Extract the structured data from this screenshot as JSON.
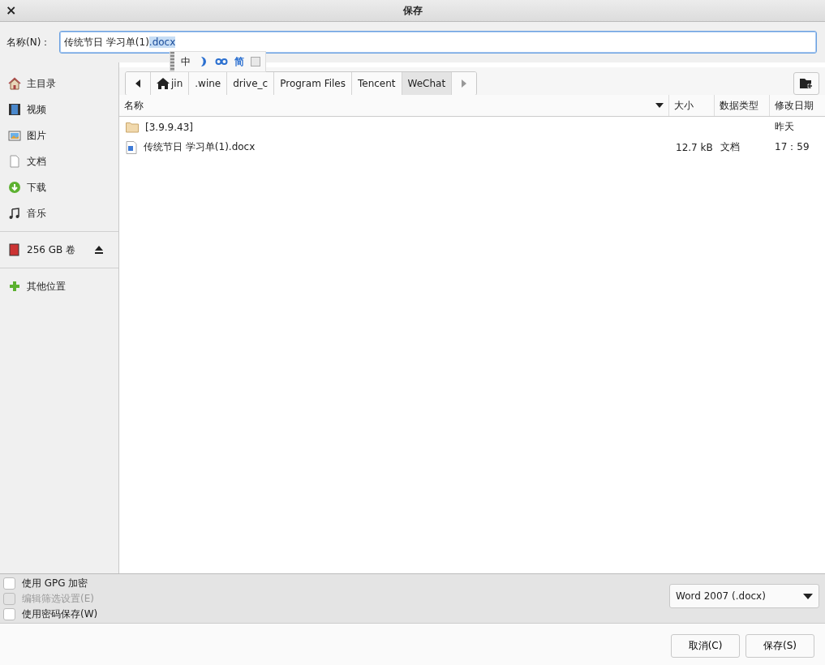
{
  "window": {
    "title": "保存",
    "close": "×"
  },
  "name_field": {
    "label": "名称(N)：",
    "value": "传统节日 学习单(1)",
    "selected_text": ".docx"
  },
  "ime_toolbar": {
    "items": [
      {
        "kind": "text",
        "label": "中"
      },
      {
        "kind": "moon"
      },
      {
        "kind": "dots"
      },
      {
        "kind": "text",
        "label": "简"
      },
      {
        "kind": "box"
      }
    ]
  },
  "sidebar": {
    "groups": [
      [
        {
          "label": "主目录",
          "kind": "home"
        },
        {
          "label": "视频",
          "kind": "video"
        },
        {
          "label": "图片",
          "kind": "image"
        },
        {
          "label": "文档",
          "kind": "doc"
        },
        {
          "label": "下载",
          "kind": "download"
        },
        {
          "label": "音乐",
          "kind": "music"
        }
      ],
      [
        {
          "label": "256 GB 卷",
          "kind": "card",
          "eject": true
        }
      ],
      [
        {
          "label": "其他位置",
          "kind": "plus"
        }
      ]
    ]
  },
  "path_bar": {
    "segments": [
      {
        "label": "jin",
        "home": true,
        "selected": false
      },
      {
        "label": ".wine",
        "home": false,
        "selected": false
      },
      {
        "label": "drive_c",
        "home": false,
        "selected": false
      },
      {
        "label": "Program Files",
        "home": false,
        "selected": false
      },
      {
        "label": "Tencent",
        "home": false,
        "selected": false
      },
      {
        "label": "WeChat",
        "home": false,
        "selected": true
      }
    ]
  },
  "table": {
    "columns": [
      "名称",
      "大小",
      "数据类型",
      "修改日期"
    ],
    "rows": [
      {
        "kind": "folder",
        "name": "[3.9.9.43]",
        "modified": "昨天"
      },
      {
        "kind": "document",
        "name": "传统节日 学习单(1).docx",
        "size": "12.7 kB",
        "type": "文档",
        "modified": "17：59"
      }
    ]
  },
  "options": [
    {
      "label": "使用 GPG 加密",
      "checked": false,
      "disabled": false
    },
    {
      "label": "编辑筛选设置(E)",
      "checked": false,
      "disabled": true
    },
    {
      "label": "使用密码保存(W)",
      "checked": false,
      "disabled": false
    }
  ],
  "filter": {
    "value": "Word 2007 (.docx)"
  },
  "buttons": [
    "取消(C)",
    "保存(S)"
  ]
}
